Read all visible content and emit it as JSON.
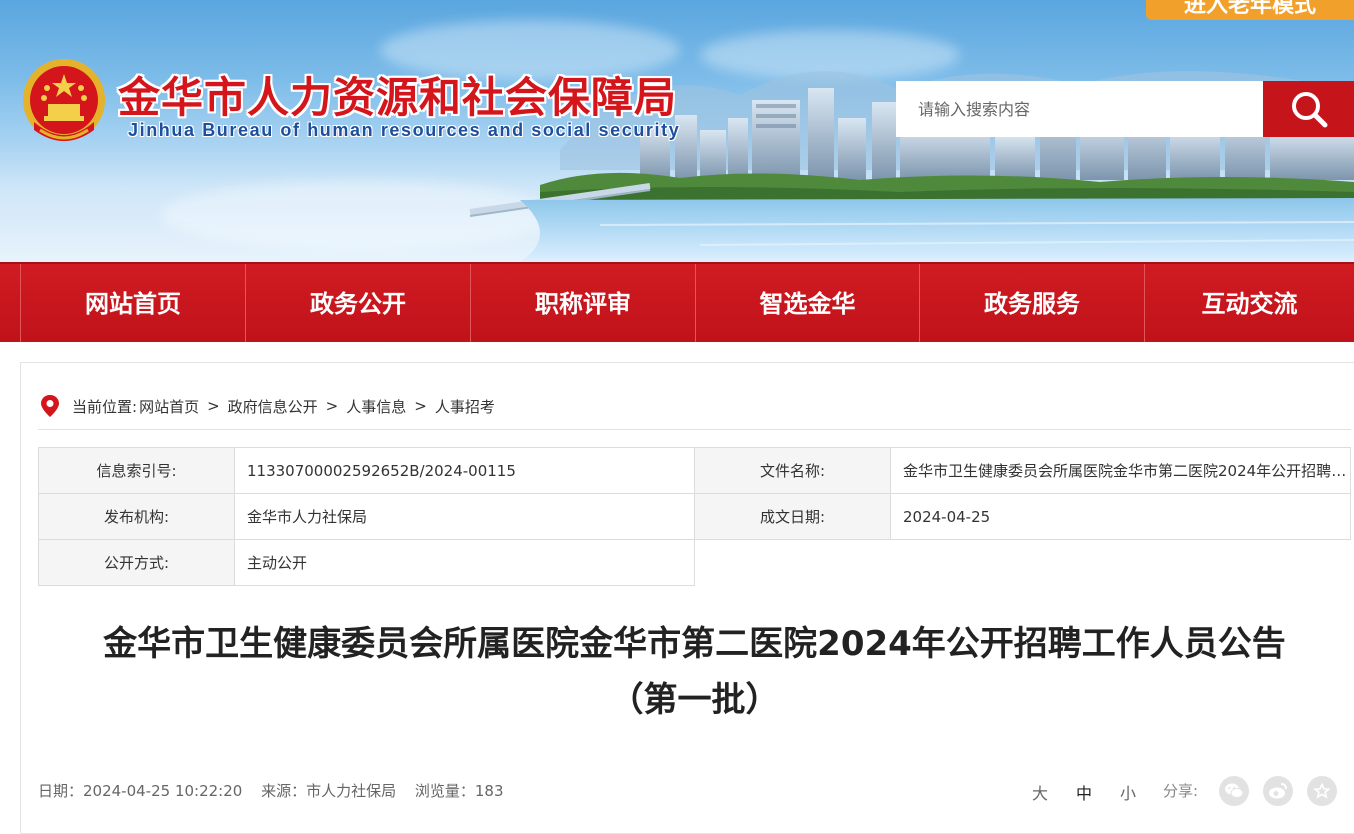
{
  "header": {
    "elder_mode_label": "进入老年模式",
    "title": "金华市人力资源和社会保障局",
    "subtitle": "Jinhua Bureau of human resources and social security",
    "search_placeholder": "请输入搜索内容"
  },
  "nav": {
    "items": [
      {
        "label": "网站首页"
      },
      {
        "label": "政务公开"
      },
      {
        "label": "职称评审"
      },
      {
        "label": "智选金华"
      },
      {
        "label": "政务服务"
      },
      {
        "label": "互动交流"
      }
    ]
  },
  "breadcrumb": {
    "prefix": "当前位置:",
    "items": [
      "网站首页",
      "政府信息公开",
      "人事信息",
      "人事招考"
    ],
    "separator": ">"
  },
  "meta": {
    "index_label": "信息索引号:",
    "index_value": "11330700002592652B/2024-00115",
    "file_label": "文件名称:",
    "file_value": "金华市卫生健康委员会所属医院金华市第二医院2024年公开招聘工作人员公告（第一批）",
    "publisher_label": "发布机构:",
    "publisher_value": "金华市人力社保局",
    "date_label": "成文日期:",
    "date_value": "2024-04-25",
    "method_label": "公开方式:",
    "method_value": "主动公开"
  },
  "article": {
    "title_line1": "金华市卫生健康委员会所属医院金华市第二医院2024年公开招聘工作人员公告",
    "title_line2": "（第一批）",
    "date_text": "日期：2024-04-25 10:22:20",
    "source_text": "来源：市人力社保局",
    "views_text": "浏览量：183"
  },
  "font_size": {
    "large": "大",
    "medium": "中",
    "small": "小"
  },
  "share": {
    "label": "分享:",
    "icons": [
      "wechat-icon",
      "weibo-icon",
      "favorite-icon"
    ]
  },
  "colors": {
    "brand_red": "#c5141a",
    "elder_orange": "#f2a02c",
    "title_blue": "#1e4f9c"
  }
}
